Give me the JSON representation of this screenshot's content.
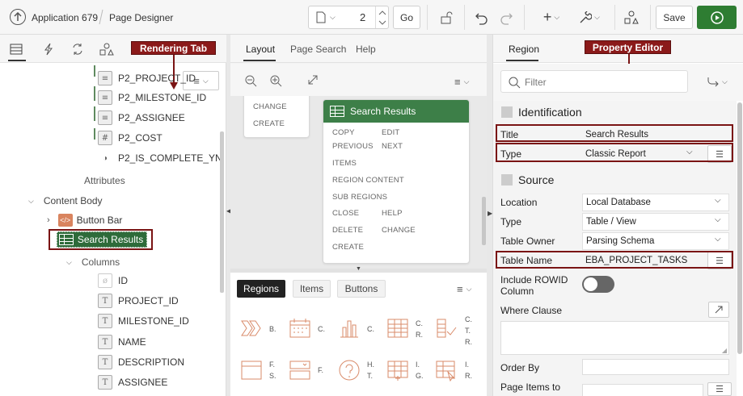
{
  "topbar": {
    "app_label": "Application 679",
    "page_designer_label": "Page Designer",
    "page_number": "2",
    "go_label": "Go",
    "save_label": "Save"
  },
  "left": {
    "callout": "Rendering Tab",
    "items": [
      {
        "label": "P2_PROJECT_ID"
      },
      {
        "label": "P2_MILESTONE_ID"
      },
      {
        "label": "P2_ASSIGNEE"
      },
      {
        "label": "P2_COST"
      },
      {
        "label": "P2_IS_COMPLETE_YN"
      }
    ],
    "attributes_label": "Attributes",
    "content_body_label": "Content Body",
    "button_bar_label": "Button Bar",
    "search_results_label": "Search Results",
    "columns_label": "Columns",
    "columns": [
      "ID",
      "PROJECT_ID",
      "MILESTONE_ID",
      "NAME",
      "DESCRIPTION",
      "ASSIGNEE"
    ]
  },
  "middle": {
    "tabs": [
      "Layout",
      "Page Search",
      "Help"
    ],
    "left_card": [
      "CHANGE",
      "CREATE"
    ],
    "card_title": "Search Results",
    "card_rows": [
      [
        "COPY",
        "EDIT"
      ],
      [
        "PREVIOUS",
        "NEXT"
      ],
      [
        "ITEMS",
        ""
      ],
      [
        "REGION CONTENT",
        ""
      ],
      [
        "SUB REGIONS",
        ""
      ],
      [
        "CLOSE",
        "HELP"
      ],
      [
        "DELETE",
        "CHANGE"
      ],
      [
        "CREATE",
        ""
      ]
    ],
    "gallery_tabs": [
      "Regions",
      "Items",
      "Buttons"
    ],
    "gallery_row1": [
      {
        "l1": "B.",
        "l2": "",
        "l3": ""
      },
      {
        "l1": "C.",
        "l2": "",
        "l3": ""
      },
      {
        "l1": "C.",
        "l2": "",
        "l3": ""
      },
      {
        "l1": "C.",
        "l2": "R.",
        "l3": ""
      },
      {
        "l1": "C.",
        "l2": "T.",
        "l3": "R."
      }
    ],
    "gallery_row2": [
      {
        "l1": "F.",
        "l2": "S.",
        "l3": ""
      },
      {
        "l1": "F.",
        "l2": "",
        "l3": ""
      },
      {
        "l1": "H.",
        "l2": "T.",
        "l3": ""
      },
      {
        "l1": "I.",
        "l2": "G.",
        "l3": ""
      },
      {
        "l1": "I.",
        "l2": "R.",
        "l3": ""
      }
    ]
  },
  "right": {
    "tab": "Region",
    "callout": "Property Editor",
    "filter_placeholder": "Filter",
    "identification_label": "Identification",
    "title_label": "Title",
    "title_value": "Search Results",
    "type_label": "Type",
    "type_value": "Classic Report",
    "source_label": "Source",
    "location_label": "Location",
    "location_value": "Local Database",
    "type2_label": "Type",
    "type2_value": "Table / View",
    "owner_label": "Table Owner",
    "owner_value": "Parsing Schema",
    "table_name_label": "Table Name",
    "table_name_value": "EBA_PROJECT_TASKS",
    "rowid_label_1": "Include ROWID",
    "rowid_label_2": "Column",
    "where_label": "Where Clause",
    "order_label": "Order By",
    "page_items_label": "Page Items to"
  }
}
